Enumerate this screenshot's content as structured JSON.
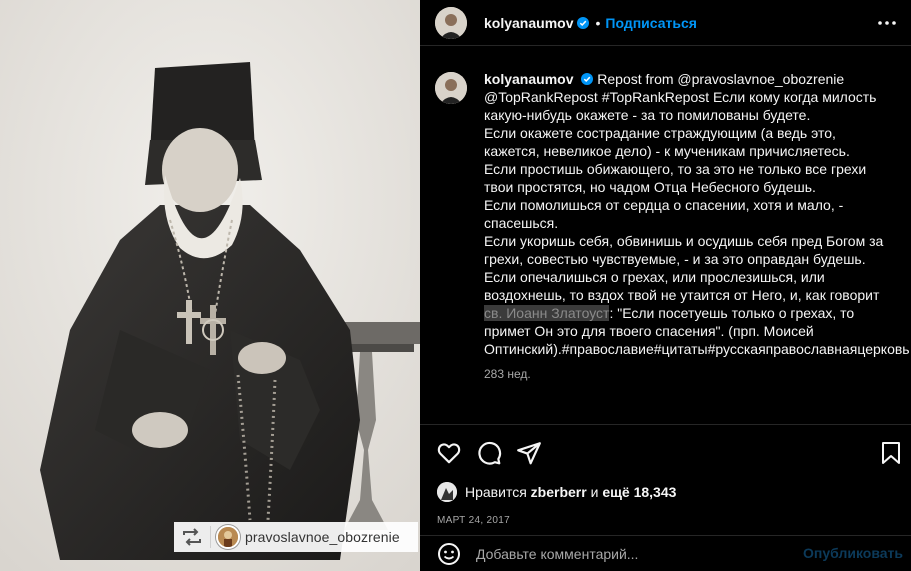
{
  "post": {
    "author": "kolyanaumov",
    "follow_label": "Подписаться",
    "separator": "•",
    "caption_segments": [
      "Repost from @pravoslavnoe_obozrenie",
      "@TopRankRepost #TopRankRepost Если кому когда милость какую-нибудь окажете - за то помилованы будете.",
      "Если окажете сострадание страждующим (а ведь это, кажется, невеликое дело) - к мученикам причисляетесь.",
      "Если простишь обижающего, то за это не только все грехи твои простятся, но чадом Отца Небесного будешь.",
      "Если помолишься от сердца о спасении, хотя и мало, - спасешься.",
      "Если укоришь себя, обвинишь и осудишь себя пред Богом за грехи, совестью чувствуемые, - и за это оправдан будешь.",
      "Если опечалишься о грехах, или прослезишься, или воздохнешь, то вздох твой не утаится от Него, и, как говорит",
      "св. Иоанн Златоуст",
      ": \"Если посетуешь только о грехах, то примет Он это для твоего спасения\". (прп. Моисей Оптинский).#православие#цитаты#русскаяправославнаяцерковь"
    ],
    "time_ago": "283 нед.",
    "likes": {
      "prefix": "Нравится",
      "user": "zberberr",
      "middle": "и",
      "count": "ещё 18,343"
    },
    "date": "МАРТ 24, 2017",
    "comment": {
      "placeholder": "Добавьте комментарий...",
      "publish_label": "Опубликовать"
    }
  },
  "repost_badge": {
    "username": "pravoslavnoe_obozrenie"
  },
  "icons": {
    "more": "more-horizontal-icon",
    "like": "heart-icon",
    "comment": "comment-icon",
    "share": "send-icon",
    "save": "bookmark-icon",
    "emoji": "smiley-icon",
    "repost": "repost-icon",
    "verified": "verified-badge-icon"
  },
  "colors": {
    "accent": "#0095f6",
    "publish_disabled": "#0c3a5a",
    "background": "#000000",
    "muted": "#a8a8a8"
  }
}
